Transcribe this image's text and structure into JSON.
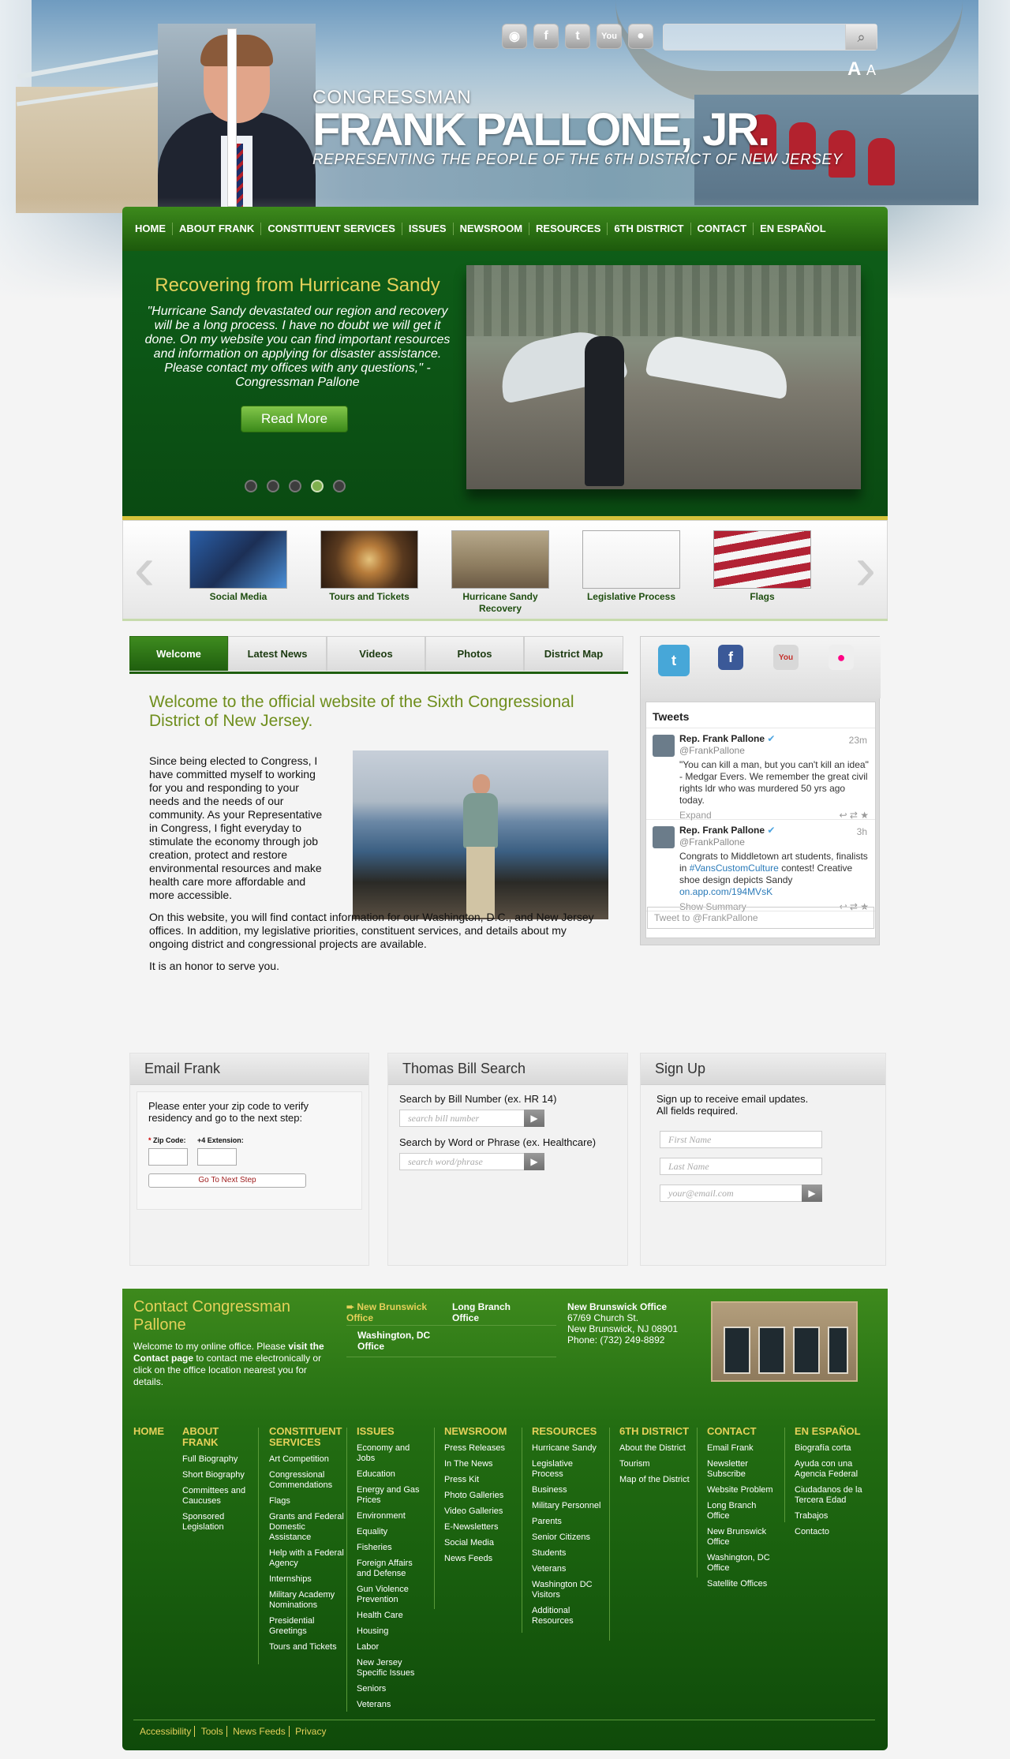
{
  "header": {
    "subtitle_top": "CONGRESSMAN",
    "name": "FRANK PALLONE, JR.",
    "tagline": "REPRESENTING THE PEOPLE OF THE 6TH DISTRICT OF NEW JERSEY",
    "font_size_large": "A",
    "font_size_small": "A",
    "social_icons": [
      "rss-icon",
      "facebook-icon",
      "twitter-icon",
      "youtube-icon",
      "flickr-icon"
    ]
  },
  "nav": {
    "items": [
      "HOME",
      "ABOUT FRANK",
      "CONSTITUENT SERVICES",
      "ISSUES",
      "NEWSROOM",
      "RESOURCES",
      "6TH DISTRICT",
      "CONTACT",
      "EN ESPAÑOL"
    ]
  },
  "hero": {
    "title": "Recovering from Hurricane Sandy",
    "quote": "\"Hurricane Sandy devastated our region and recovery will be a long process. I have no doubt we will get it done. On my website you can find important resources and information on applying for disaster assistance. Please contact my offices with any questions,\" - Congressman Pallone",
    "button": "Read More",
    "active_slide": 4,
    "slide_count": 5
  },
  "carousel": {
    "items": [
      {
        "label": "Social Media"
      },
      {
        "label": "Tours and Tickets"
      },
      {
        "label": "Hurricane Sandy Recovery"
      },
      {
        "label": "Legislative Process"
      },
      {
        "label": "Flags"
      }
    ]
  },
  "tabs": [
    "Welcome",
    "Latest News",
    "Videos",
    "Photos",
    "District Map"
  ],
  "welcome": {
    "title": "Welcome to the official website of the Sixth Congressional District of New Jersey.",
    "p1": "Since being elected to Congress, I have committed myself to working for you and responding to your needs and the needs of our community.  As your Representative in Congress, I fight everyday to stimulate the economy through job creation, protect and restore environmental resources and make health care more affordable and more accessible.",
    "p2": "On this website, you will find contact information for our Washington, D.C., and New Jersey offices.  In addition, my legislative priorities, constituent services, and details about my ongoing district and congressional projects are available.",
    "p3": "It is an honor to serve you."
  },
  "twitter": {
    "header": "Tweets",
    "tweets": [
      {
        "name": "Rep. Frank Pallone",
        "handle": "@FrankPallone",
        "time": "23m",
        "text": "\"You can kill a man, but you can't kill an idea\" - Medgar Evers. We remember the great civil rights ldr who was murdered 50 yrs ago today.",
        "action": "Expand"
      },
      {
        "name": "Rep. Frank Pallone",
        "handle": "@FrankPallone",
        "time": "3h",
        "text_a": "Congrats to Middletown art students, finalists in ",
        "hashtag": "#VansCustomCulture",
        "text_b": " contest! Creative shoe design depicts Sandy ",
        "link": "on.app.com/194MVsK",
        "action": "Show Summary"
      }
    ],
    "input_placeholder": "Tweet to @FrankPallone"
  },
  "email_frank": {
    "title": "Email Frank",
    "instructions": "Please enter your zip code to verify residency and go to the next step:",
    "zip_label": "Zip Code:",
    "ext_label": "+4 Extension:",
    "button": "Go To Next Step"
  },
  "bill_search": {
    "title": "Thomas Bill Search",
    "label1": "Search by Bill Number (ex. HR 14)",
    "placeholder1": "search bill number",
    "label2": "Search by Word or Phrase (ex. Healthcare)",
    "placeholder2": "search word/phrase"
  },
  "signup": {
    "title": "Sign Up",
    "text1": "Sign up to receive email updates.",
    "text2": "All fields required.",
    "first": "First Name",
    "last": "Last Name",
    "email": "your@email.com"
  },
  "contact": {
    "title": "Contact Congressman Pallone",
    "text_a": "Welcome to my online office. Please ",
    "text_bold": "visit the Contact page",
    "text_b": " to contact me electronically or click on the office location nearest you for details.",
    "offices": [
      "New Brunswick Office",
      "Long Branch Office",
      "Washington, DC Office"
    ],
    "selected_office": {
      "name": "New Brunswick Office",
      "line1": "67/69 Church St.",
      "line2": "New Brunswick, NJ 08901",
      "phone": "Phone: (732) 249-8892"
    }
  },
  "footer": {
    "columns": [
      {
        "heading": "HOME",
        "items": []
      },
      {
        "heading": "ABOUT FRANK",
        "items": [
          "Full Biography",
          "Short Biography",
          "Committees and Caucuses",
          "Sponsored Legislation"
        ]
      },
      {
        "heading": "CONSTITUENT SERVICES",
        "items": [
          "Art Competition",
          "Congressional Commendations",
          "Flags",
          "Grants and Federal Domestic Assistance",
          "Help with a Federal Agency",
          "Internships",
          "Military Academy Nominations",
          "Presidential Greetings",
          "Tours and Tickets"
        ]
      },
      {
        "heading": "ISSUES",
        "items": [
          "Economy and Jobs",
          "Education",
          "Energy and Gas Prices",
          "Environment",
          "Equality",
          "Fisheries",
          "Foreign Affairs and Defense",
          "Gun Violence Prevention",
          "Health Care",
          "Housing",
          "Labor",
          "New Jersey Specific Issues",
          "Seniors",
          "Veterans"
        ]
      },
      {
        "heading": "NEWSROOM",
        "items": [
          "Press Releases",
          "In The News",
          "Press Kit",
          "Photo Galleries",
          "Video Galleries",
          "E-Newsletters",
          "Social Media",
          "News Feeds"
        ]
      },
      {
        "heading": "RESOURCES",
        "items": [
          "Hurricane Sandy",
          "Legislative Process",
          "Business",
          "Military Personnel",
          "Parents",
          "Senior Citizens",
          "Students",
          "Veterans",
          "Washington DC Visitors",
          "Additional Resources"
        ]
      },
      {
        "heading": "6TH DISTRICT",
        "items": [
          "About the District",
          "Tourism",
          "Map of the District"
        ]
      },
      {
        "heading": "CONTACT",
        "items": [
          "Email Frank",
          "Newsletter Subscribe",
          "Website Problem",
          "Long Branch Office",
          "New Brunswick Office",
          "Washington, DC Office",
          "Satellite Offices"
        ]
      },
      {
        "heading": "EN ESPAÑOL",
        "items": [
          "Biografía corta",
          "Ayuda con una Agencia Federal",
          "Ciudadanos de la Tercera Edad",
          "Trabajos",
          "Contacto"
        ]
      }
    ],
    "bottom_links": [
      "Accessibility",
      "Tools",
      "News Feeds",
      "Privacy"
    ]
  },
  "colors": {
    "brand_green": "#1d5a0c",
    "gold": "#e5d05a",
    "title_olive": "#6f8e1c"
  }
}
